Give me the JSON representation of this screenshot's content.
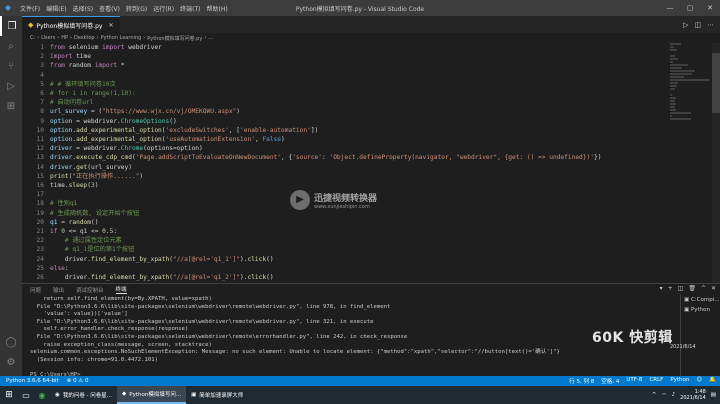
{
  "titlebar": {
    "menu": [
      "文件(F)",
      "编辑(E)",
      "选择(S)",
      "查看(V)",
      "转到(G)",
      "运行(R)",
      "终端(T)",
      "帮助(H)"
    ],
    "title": "Python模拟填写问卷.py - Visual Studio Code"
  },
  "tab": {
    "label": "Python模拟填写问卷.py"
  },
  "breadcrumb": [
    "C:",
    "Users",
    "HP",
    "Desktop",
    "Python Learning",
    "Python模拟填写问卷.py",
    "..."
  ],
  "code": [
    [
      [
        "c-kw",
        "from "
      ],
      [
        "c-pl",
        "selenium "
      ],
      [
        "c-kw",
        "import "
      ],
      [
        "c-pl",
        "webdriver"
      ]
    ],
    [
      [
        "c-kw",
        "import "
      ],
      [
        "c-pl",
        "time"
      ]
    ],
    [
      [
        "c-kw",
        "from "
      ],
      [
        "c-pl",
        "random "
      ],
      [
        "c-kw",
        "import "
      ],
      [
        "c-pl",
        "*"
      ]
    ],
    [],
    [
      [
        "c-cm",
        "# # 循环填写问卷10次"
      ]
    ],
    [
      [
        "c-cm",
        "# for i in range(1,10):"
      ]
    ],
    [
      [
        "c-cm",
        "# 启动问卷url"
      ]
    ],
    [
      [
        "c-var",
        "url_survey "
      ],
      [
        "c-pl",
        "= ("
      ],
      [
        "c-str",
        "\"https://www.wjx.cn/vj/OMEKQWU.aspx\""
      ],
      [
        "c-pl",
        ")"
      ]
    ],
    [
      [
        "c-var",
        "option "
      ],
      [
        "c-pl",
        "= webdriver."
      ],
      [
        "c-cls",
        "ChromeOptions"
      ],
      [
        "c-pl",
        "()"
      ]
    ],
    [
      [
        "c-var",
        "option"
      ],
      [
        "c-pl",
        "."
      ],
      [
        "c-fn",
        "add_experimental_option"
      ],
      [
        "c-pl",
        "("
      ],
      [
        "c-str",
        "'excludeSwitches'"
      ],
      [
        "c-pl",
        ", ["
      ],
      [
        "c-str",
        "'enable-automation'"
      ],
      [
        "c-pl",
        "])"
      ]
    ],
    [
      [
        "c-var",
        "option"
      ],
      [
        "c-pl",
        "."
      ],
      [
        "c-fn",
        "add_experimental_option"
      ],
      [
        "c-pl",
        "("
      ],
      [
        "c-str",
        "'useAutomationExtension'"
      ],
      [
        "c-pl",
        ", "
      ],
      [
        "c-kw2",
        "False"
      ],
      [
        "c-pl",
        ")"
      ]
    ],
    [
      [
        "c-var",
        "driver "
      ],
      [
        "c-pl",
        "= webdriver."
      ],
      [
        "c-cls",
        "Chrome"
      ],
      [
        "c-pl",
        "(options=option)"
      ]
    ],
    [
      [
        "c-var",
        "driver"
      ],
      [
        "c-pl",
        "."
      ],
      [
        "c-fn",
        "execute_cdp_cmd"
      ],
      [
        "c-pl",
        "("
      ],
      [
        "c-str",
        "'Page.addScriptToEvaluateOnNewDocument'"
      ],
      [
        "c-pl",
        ", {"
      ],
      [
        "c-str",
        "'source'"
      ],
      [
        "c-pl",
        ": "
      ],
      [
        "c-str",
        "'Object.defineProperty(navigator, \"webdriver\", {get: () => undefined})'"
      ],
      [
        "c-pl",
        "})"
      ]
    ],
    [
      [
        "c-var",
        "driver"
      ],
      [
        "c-pl",
        "."
      ],
      [
        "c-fn",
        "get"
      ],
      [
        "c-pl",
        "(url_survey)"
      ]
    ],
    [
      [
        "c-fn",
        "print"
      ],
      [
        "c-pl",
        "("
      ],
      [
        "c-str",
        "\"正在执行操作......\""
      ],
      [
        "c-pl",
        ")"
      ]
    ],
    [
      [
        "c-pl",
        "time."
      ],
      [
        "c-fn",
        "sleep"
      ],
      [
        "c-pl",
        "("
      ],
      [
        "c-num",
        "3"
      ],
      [
        "c-pl",
        ")"
      ]
    ],
    [],
    [
      [
        "c-cm",
        "# 性别q1"
      ]
    ],
    [
      [
        "c-cm",
        "# 生成随机数, 设定开始个按钮"
      ]
    ],
    [
      [
        "c-var",
        "q1 "
      ],
      [
        "c-pl",
        "= "
      ],
      [
        "c-fn",
        "random"
      ],
      [
        "c-pl",
        "()"
      ]
    ],
    [
      [
        "c-kw",
        "if "
      ],
      [
        "c-num",
        "0 "
      ],
      [
        "c-pl",
        "<= q1 <= "
      ],
      [
        "c-num",
        "0.5"
      ],
      [
        "c-pl",
        ":"
      ]
    ],
    [
      [
        "c-cm",
        "    # 通过属性定位元素"
      ]
    ],
    [
      [
        "c-cm",
        "    # q1_1是位的第1个按钮"
      ]
    ],
    [
      [
        "c-pl",
        "    driver."
      ],
      [
        "c-fn",
        "find_element_by_xpath"
      ],
      [
        "c-pl",
        "("
      ],
      [
        "c-str",
        "\"//a[@rel='q1_1']\""
      ],
      [
        "c-pl",
        ")."
      ],
      [
        "c-fn",
        "click"
      ],
      [
        "c-pl",
        "()"
      ]
    ],
    [
      [
        "c-kw",
        "else"
      ],
      [
        "c-pl",
        ":"
      ]
    ],
    [
      [
        "c-pl",
        "    driver."
      ],
      [
        "c-fn",
        "find_element_by_xpath"
      ],
      [
        "c-pl",
        "("
      ],
      [
        "c-str",
        "\"//a[@rel='q1_2']\""
      ],
      [
        "c-pl",
        ")."
      ],
      [
        "c-fn",
        "click"
      ],
      [
        "c-pl",
        "()"
      ]
    ]
  ],
  "watermark": {
    "main": "迅捷视频转换器",
    "sub": "www.xunjieshipin.com"
  },
  "panel": {
    "tabs": [
      "问题",
      "输出",
      "调试控制台",
      "终端"
    ],
    "active_tab": "终端",
    "terminal_lines": [
      "    return self.find_element(by=By.XPATH, value=xpath)",
      "  File \"D:\\Python3.6.6\\lib\\site-packages\\selenium\\webdriver\\remote\\webdriver.py\", line 978, in find_element",
      "    'value': value})['value']",
      "  File \"D:\\Python3.6.6\\lib\\site-packages\\selenium\\webdriver\\remote\\webdriver.py\", line 321, in execute",
      "    self.error_handler.check_response(response)",
      "  File \"D:\\Python3.6.6\\lib\\site-packages\\selenium\\webdriver\\remote\\errorhandler.py\", line 242, in check_response",
      "    raise exception_class(message, screen, stacktrace)",
      "selenium.common.exceptions.NoSuchElementException: Message: no such element: Unable to locate element: {\"method\":\"xpath\",\"selector\":\"//button[text()='确认']\"}",
      "  (Session info: chrome=91.0.4472.101)",
      "",
      "PS C:\\Users\\HP> "
    ],
    "side": [
      "C:Compi...",
      "Python"
    ]
  },
  "kuaishou": {
    "logo": "60K 快剪辑",
    "date": "2021/6/14"
  },
  "statusbar": {
    "left": [
      "Python 3.6.6 64-bit",
      "⊗ 0 ⚠ 0"
    ],
    "right": [
      "行 5, 列 8",
      "空格: 4",
      "UTF-8",
      "CRLF",
      "Python",
      "☺",
      "🔔"
    ]
  },
  "taskbar": {
    "tasks": [
      {
        "label": "我的问卷 - 问卷星...",
        "active": false
      },
      {
        "label": "Python模拟填写问...",
        "active": true
      },
      {
        "label": "简单加速录屏大师",
        "active": false
      }
    ],
    "time": "1:48",
    "date": "2021/6/14"
  }
}
